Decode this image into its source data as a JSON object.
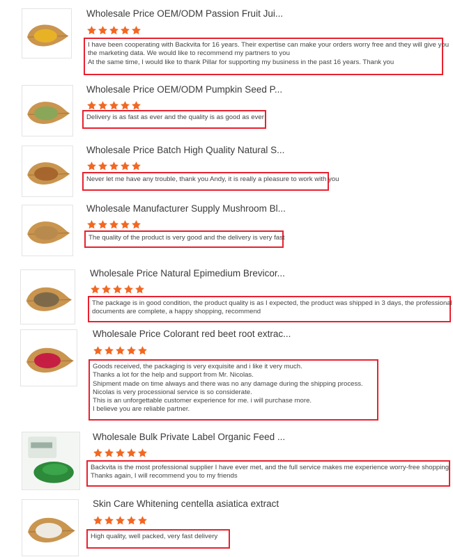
{
  "colors": {
    "star": "#f26722",
    "highlight_border": "#e8212e"
  },
  "reviews": [
    {
      "product_title": "Wholesale Price OEM/ODM Passion Fruit Jui...",
      "rating": 5,
      "thumbnail": "yellow-powder-on-wooden-leaf-plate",
      "comment_lines": [
        "I have been cooperating with Backvita for 16 years. Their expertise can make your orders worry free and they will give you",
        "the marketing data. We would like to recommend my partners to you",
        "At the same time, I would like to thank Pillar for supporting my business in the past 16 years. Thank you"
      ]
    },
    {
      "product_title": "Wholesale Price OEM/ODM Pumpkin Seed P...",
      "rating": 5,
      "thumbnail": "green-powder-on-wooden-leaf-plate",
      "comment_lines": [
        "Delivery is as fast as ever and the quality is as good as ever"
      ]
    },
    {
      "product_title": "Wholesale Price Batch High Quality Natural S...",
      "rating": 5,
      "thumbnail": "brown-powder-on-wooden-leaf-plate",
      "comment_lines": [
        "Never let me have any trouble, thank you Andy, it is really a pleasure to work with you"
      ]
    },
    {
      "product_title": "Wholesale Manufacturer Supply Mushroom Bl...",
      "rating": 5,
      "thumbnail": "tan-powder-on-wooden-leaf-plate",
      "comment_lines": [
        "The quality of the product is very good and the delivery is very fast"
      ]
    },
    {
      "product_title": "Wholesale Price Natural Epimedium Brevicor...",
      "rating": 5,
      "thumbnail": "dried-herb-on-wooden-leaf-plate",
      "comment_lines": [
        "The package is in good condition, the product quality is as I expected, the product was shipped in 3 days, the professional",
        "documents are complete, a happy shopping, recommend"
      ]
    },
    {
      "product_title": "Wholesale Price Colorant red beet root extrac...",
      "rating": 5,
      "thumbnail": "red-powder-on-wooden-leaf-plate",
      "comment_lines": [
        "Goods received, the packaging is very exquisite and i like it very much.",
        "Thanks a lot for the help and support from Mr. Nicolas.",
        "Shipment made on time always and there was no any damage during the shipping process.",
        "Nicolas is very processional service is so considerate.",
        "This is an unforgettable customer experience for me. i will purchase more.",
        "I believe you are  reliable partner."
      ]
    },
    {
      "product_title": "Wholesale Bulk Private Label Organic Feed ...",
      "rating": 5,
      "thumbnail": "green-powder-with-branded-bag",
      "comment_lines": [
        "Backvita is the most professional supplier I have ever met, and the full service makes me experience worry-free shopping.",
        "Thanks again, I will recommend you to my friends"
      ]
    },
    {
      "product_title": "Skin Care Whitening centella asiatica extract",
      "rating": 5,
      "thumbnail": "white-powder-on-wooden-leaf-plate",
      "comment_lines": [
        "High quality, well packed, very fast delivery"
      ]
    }
  ]
}
